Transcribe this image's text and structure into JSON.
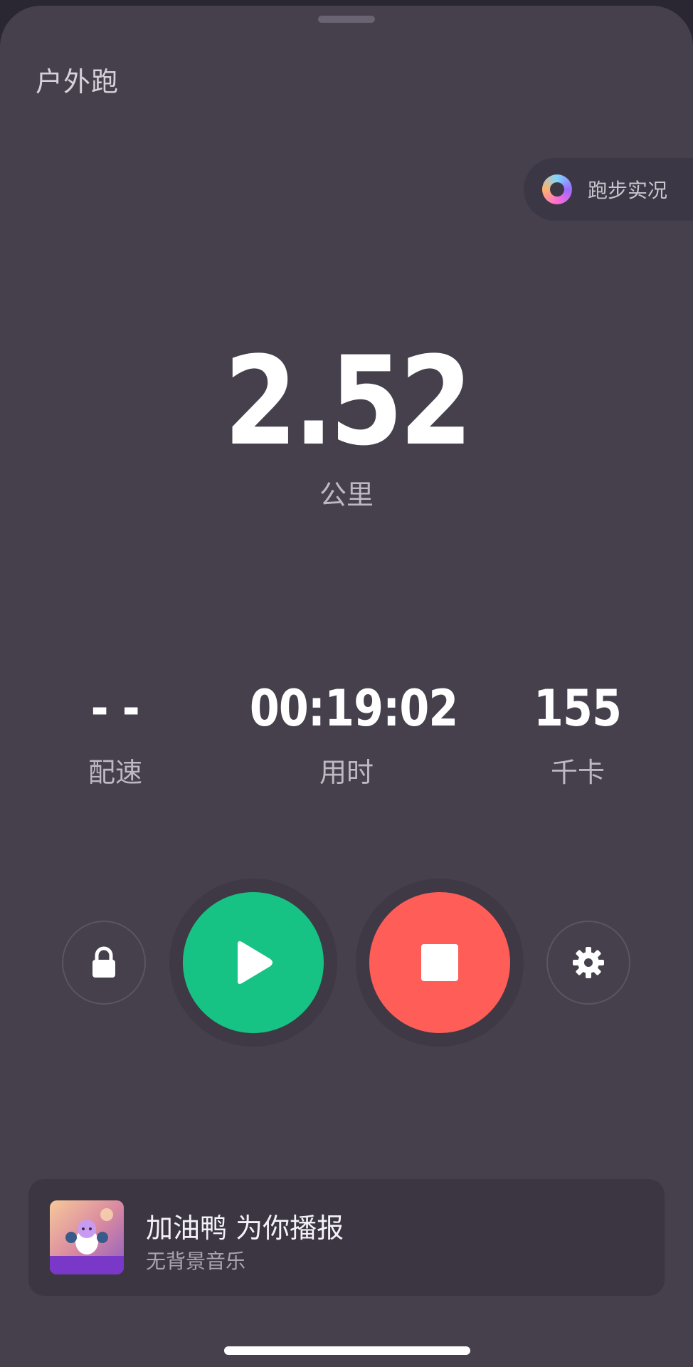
{
  "header": {
    "title": "户外跑"
  },
  "live_button": {
    "label": "跑步实况",
    "icon": "ring-icon"
  },
  "distance": {
    "value": "2.52",
    "unit": "公里"
  },
  "stats": [
    {
      "value": "- -",
      "label": "配速"
    },
    {
      "value": "00:19:02",
      "label": "用时"
    },
    {
      "value": "155",
      "label": "千卡"
    }
  ],
  "controls": {
    "lock_icon": "lock-icon",
    "play_icon": "play-icon",
    "stop_icon": "stop-icon",
    "settings_icon": "gear-icon",
    "play_color": "#17c384",
    "stop_color": "#ff5d58"
  },
  "music": {
    "title": "加油鸭 为你播报",
    "subtitle": "无背景音乐"
  },
  "colors": {
    "background": "#46404d",
    "text": "#ffffff",
    "muted": "#bdb8c2"
  }
}
